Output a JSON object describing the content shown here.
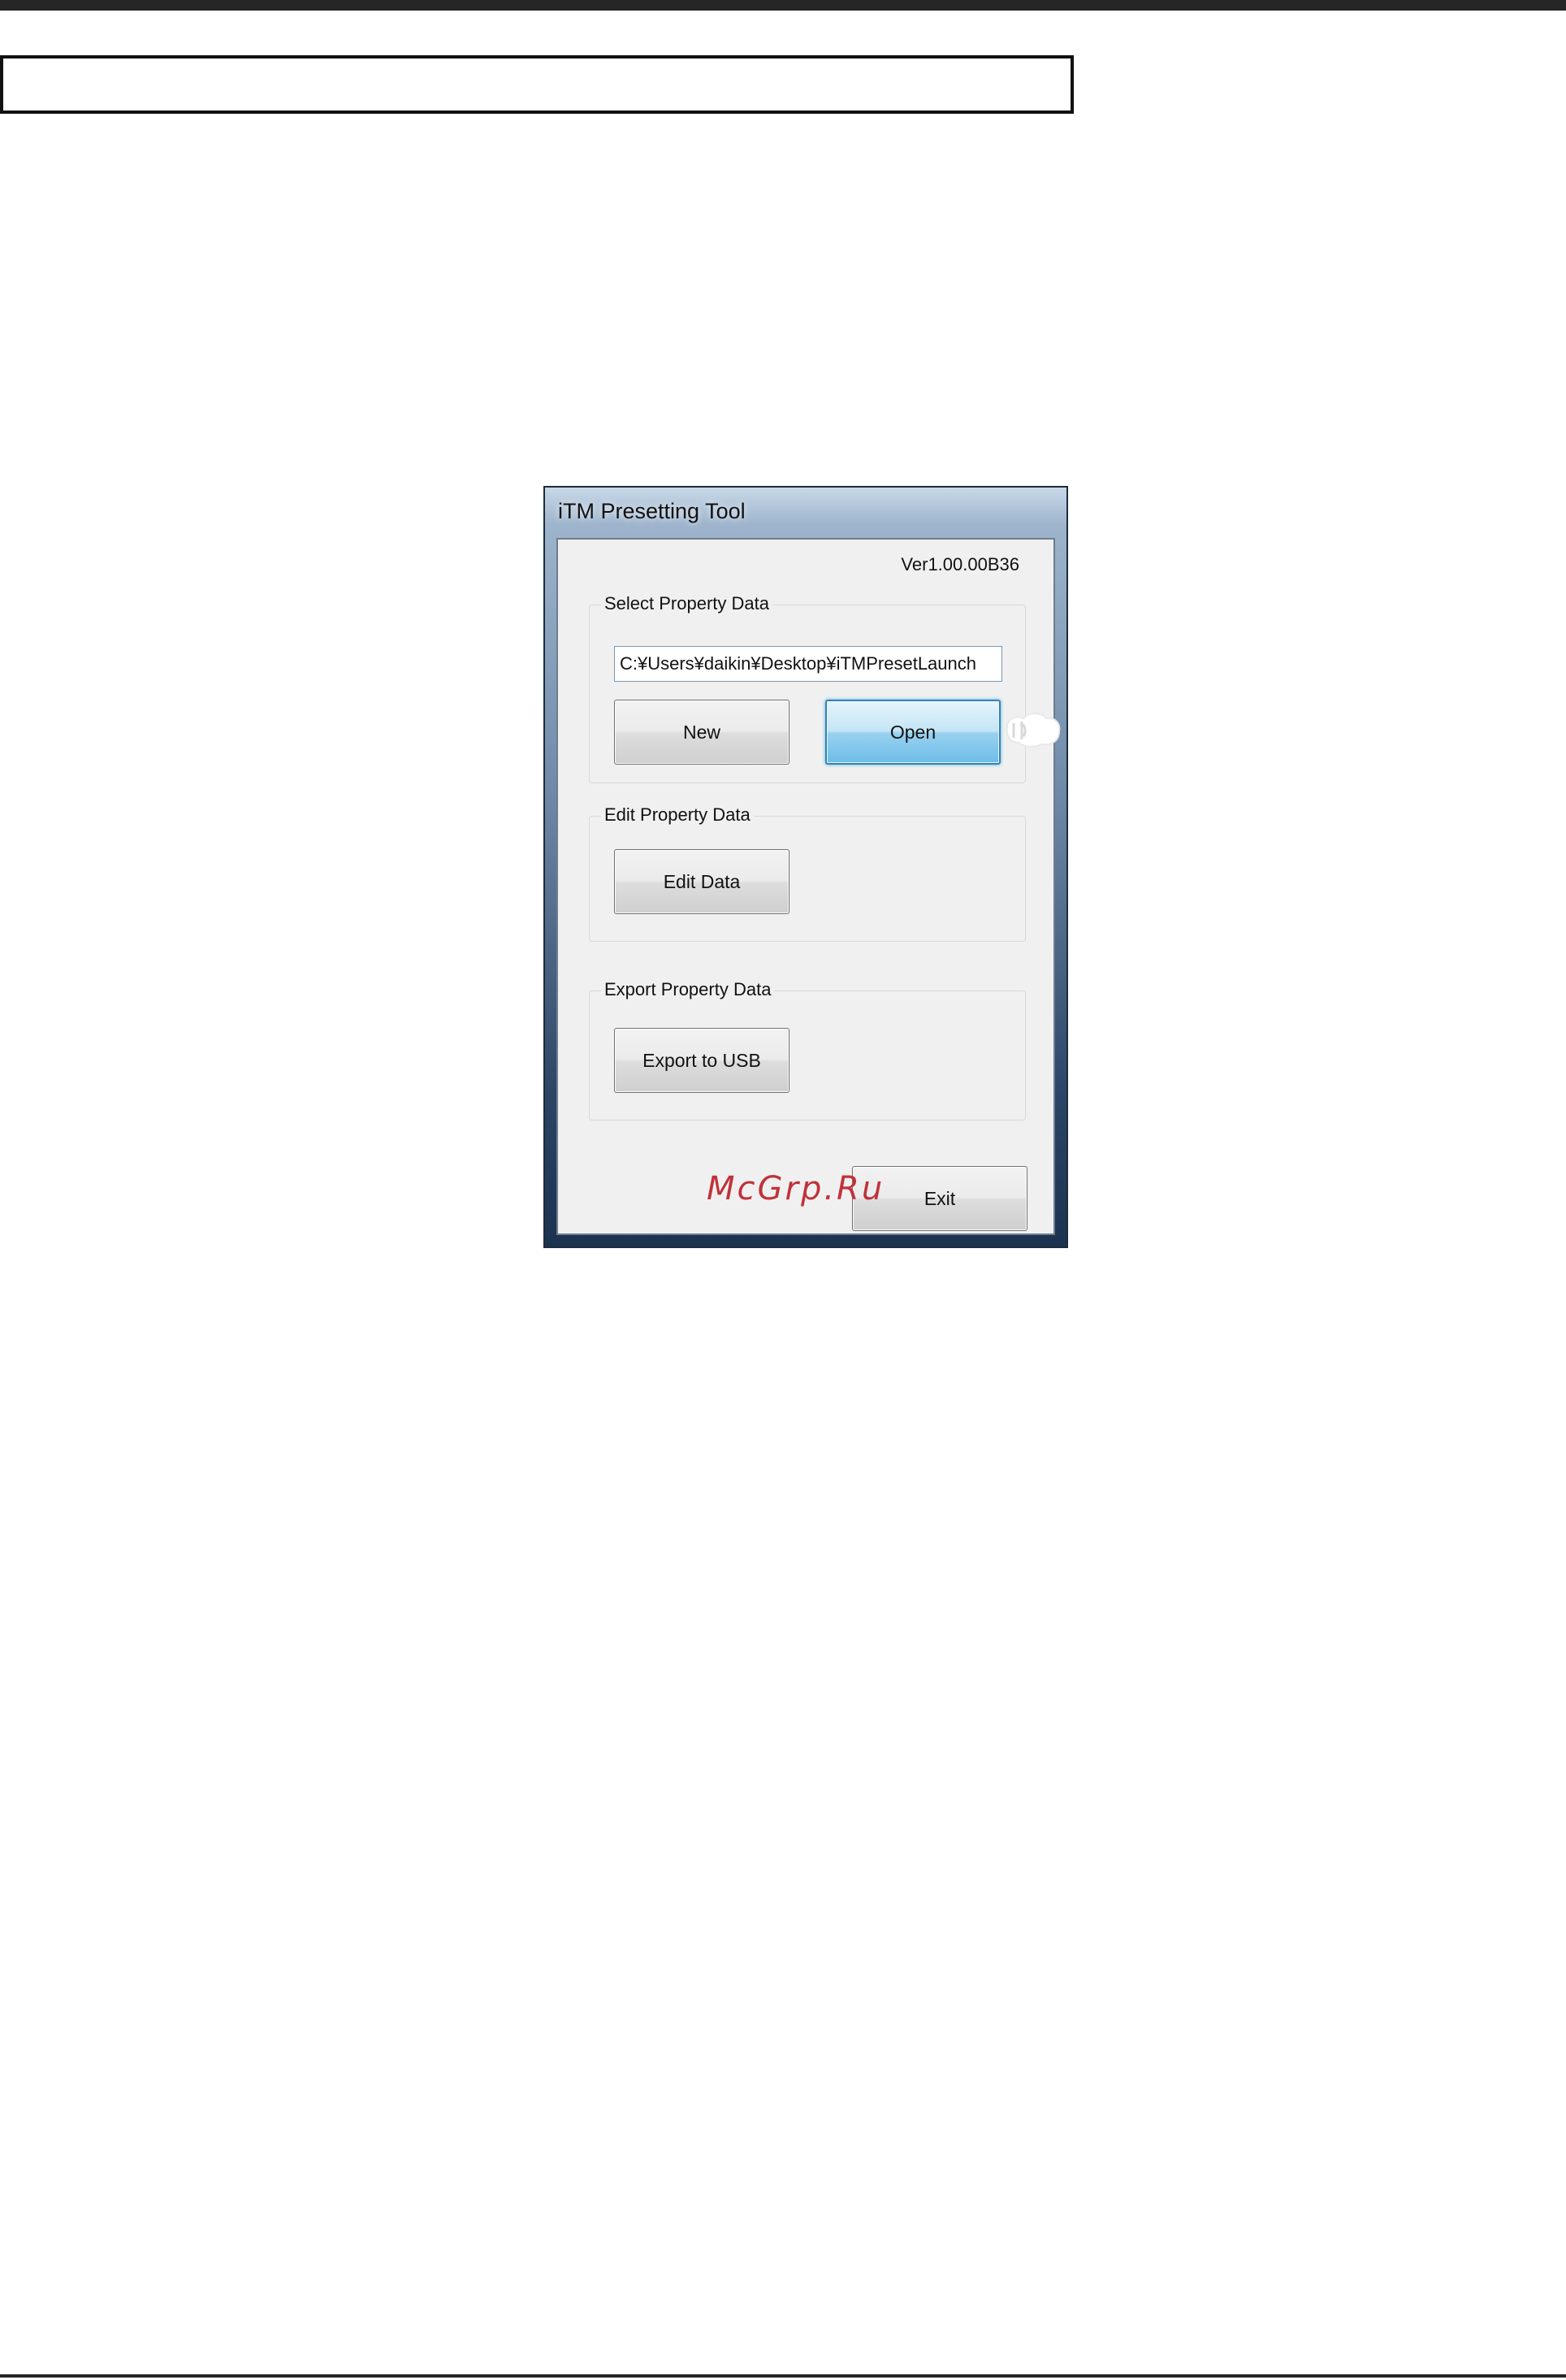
{
  "window": {
    "title": "iTM Presetting Tool",
    "version": "Ver1.00.00B36"
  },
  "select_group": {
    "label": "Select Property Data",
    "path_value": "C:¥Users¥daikin¥Desktop¥iTMPresetLaunch",
    "new_label": "New",
    "open_label": "Open"
  },
  "edit_group": {
    "label": "Edit Property Data",
    "edit_label": "Edit Data"
  },
  "export_group": {
    "label": "Export Property Data",
    "export_label": "Export to USB"
  },
  "footer": {
    "exit_label": "Exit"
  },
  "watermark": "McGrp.Ru",
  "colors": {
    "focus_border": "#3c7fb1",
    "watermark": "#c0323a"
  }
}
